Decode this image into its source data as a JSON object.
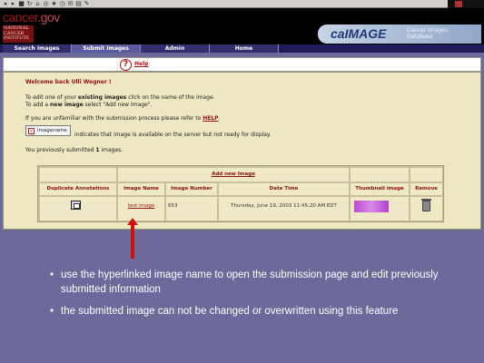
{
  "browser": {
    "toolbar_icons": [
      "back-icon",
      "forward-icon",
      "stop-icon",
      "refresh-icon",
      "home-icon",
      "search-icon",
      "favorites-icon",
      "history-icon",
      "mail-icon",
      "print-icon",
      "edit-icon"
    ]
  },
  "header": {
    "site_logo_main": "cancer",
    "site_logo_dot": ".gov",
    "nci_logo": "NATIONAL CANCER INSTITUTE",
    "brand_name": "caIMAGE",
    "brand_subtitle": "Cancer Images Database"
  },
  "nav": {
    "tabs": [
      {
        "label": "Search Images",
        "active": false
      },
      {
        "label": "Submit Images",
        "active": true
      },
      {
        "label": "Admin",
        "active": false
      },
      {
        "label": "Home",
        "active": false
      }
    ]
  },
  "help": {
    "icon_char": "?",
    "label": "Help"
  },
  "main": {
    "welcome": "Welcome back Ulli Wegner !",
    "line1_pre": "To edit one of your ",
    "line1_bold": "existing images",
    "line1_post": " click on the name of the image.",
    "line2_pre": "To add a ",
    "line2_bold": "new image",
    "line2_post": " select \"Add new Image\".",
    "line3_pre": "If you are unfamiliar with the submission process please refer to ",
    "line3_link": "HELP",
    "line3_post": ".",
    "legend_icon_char": "×",
    "legend_label": "imagename",
    "legend_text": "indicates that image is available on the server but not ready for display.",
    "submitted_pre": "You previously submitted ",
    "submitted_count": "1",
    "submitted_post": " images."
  },
  "table": {
    "add_new": "Add new Image",
    "headers": [
      "Duplicate Annotations",
      "Image Name",
      "Image Number",
      "Date Time",
      "Thumbnail image",
      "Remove"
    ],
    "rows": [
      {
        "image_name": "test image",
        "image_number": "653",
        "date_time": "Thursday, June 19, 2003 11:45:20 AM EDT"
      }
    ]
  },
  "notes": [
    "use the hyperlinked image name to open the submission page and edit previously submitted information",
    "the submitted image can not be changed or overwritten using this feature"
  ],
  "colors": {
    "slide_background": "#6b6a9a",
    "content_background": "#ede7c2",
    "accent_red": "#9a1010",
    "nav_background": "#1d1d5a"
  }
}
